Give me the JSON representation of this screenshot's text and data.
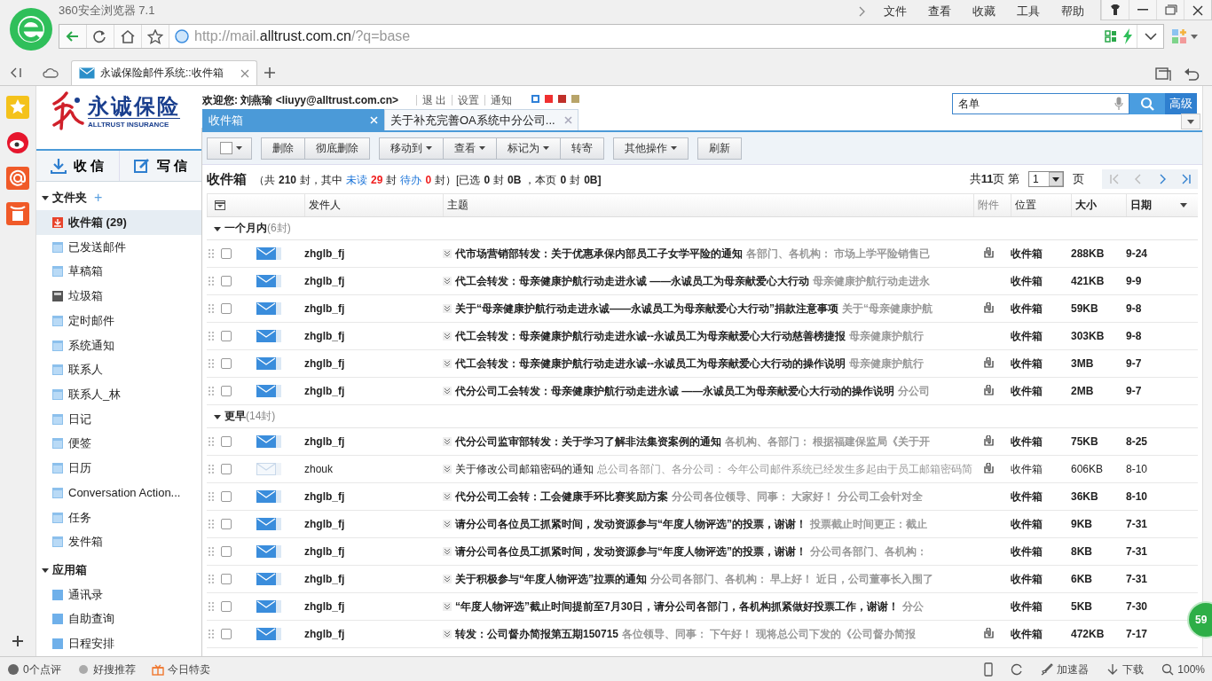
{
  "browser": {
    "title": "360安全浏览器 7.1",
    "menu": [
      "文件",
      "查看",
      "收藏",
      "工具",
      "帮助"
    ],
    "address": {
      "prefix": "http://mail.",
      "domain": "alltrust.com.cn",
      "suffix": "/?q=base"
    },
    "tabs": [
      {
        "label": "永诚保险邮件系统::收件箱",
        "selected": true
      }
    ]
  },
  "mail": {
    "logo": {
      "name": "永诚保险",
      "english": "ALLTRUST INSURANCE"
    },
    "welcome": "欢迎您: 刘燕瑜 <liuyy@alltrust.com.cn>",
    "header_links": [
      "退 出",
      "设置",
      "通知"
    ],
    "skins": [
      {
        "color": "#2f80d8",
        "selected": true
      },
      {
        "color": "#f03030",
        "selected": false
      },
      {
        "color": "#c0302a",
        "selected": false
      },
      {
        "color": "#b8a46a",
        "selected": false
      }
    ],
    "search": {
      "value": "名单",
      "advanced": "高级"
    },
    "actions": [
      "收 信",
      "写 信"
    ],
    "folder_sections": [
      {
        "title": "文件夹",
        "expanded": true,
        "add": "+",
        "items": [
          {
            "label": "收件箱 (29)",
            "kind": "inbox",
            "selected": true
          },
          {
            "label": "已发送邮件",
            "kind": "folder",
            "selected": false
          },
          {
            "label": "草稿箱",
            "kind": "folder",
            "selected": false
          },
          {
            "label": "垃圾箱",
            "kind": "trash",
            "selected": false
          },
          {
            "label": "定时邮件",
            "kind": "folder",
            "selected": false
          },
          {
            "label": "系统通知",
            "kind": "folder",
            "selected": false
          },
          {
            "label": "联系人",
            "kind": "folder",
            "selected": false
          },
          {
            "label": "联系人_林",
            "kind": "folder",
            "selected": false
          },
          {
            "label": "日记",
            "kind": "folder",
            "selected": false
          },
          {
            "label": "便签",
            "kind": "folder",
            "selected": false
          },
          {
            "label": "日历",
            "kind": "folder",
            "selected": false
          },
          {
            "label": "Conversation Action...",
            "kind": "folder",
            "selected": false
          },
          {
            "label": "任务",
            "kind": "folder",
            "selected": false
          },
          {
            "label": "发件箱",
            "kind": "folder",
            "selected": false
          }
        ]
      },
      {
        "title": "应用箱",
        "expanded": true,
        "items": [
          {
            "label": "通讯录",
            "kind": "app",
            "selected": false
          },
          {
            "label": "自助查询",
            "kind": "app",
            "selected": false
          },
          {
            "label": "日程安排",
            "kind": "app",
            "selected": false
          }
        ]
      }
    ],
    "tabs": [
      {
        "label": "收件箱",
        "selected": true
      },
      {
        "label": "关于补充完善OA系统中分公司...",
        "selected": false
      }
    ],
    "toolbar": [
      {
        "group": [
          {
            "kind": "select"
          }
        ]
      },
      {
        "group": [
          {
            "label": "删除"
          },
          {
            "label": "彻底删除"
          }
        ]
      },
      {
        "group": [
          {
            "label": "移动到",
            "menu": true
          },
          {
            "label": "查看",
            "menu": true
          },
          {
            "label": "标记为",
            "menu": true
          },
          {
            "label": "转寄"
          }
        ]
      },
      {
        "group": [
          {
            "label": "其他操作",
            "menu": true
          }
        ]
      },
      {
        "group": [
          {
            "label": "刷新"
          }
        ]
      }
    ],
    "summary": [
      {
        "text": "收件箱",
        "kind": "title"
      },
      {
        "text": "（共",
        "kind": "text"
      },
      {
        "text": "210",
        "kind": "num"
      },
      {
        "text": "封，其中",
        "kind": "text"
      },
      {
        "text": "未读",
        "kind": "link"
      },
      {
        "text": "29",
        "kind": "alert"
      },
      {
        "text": "封",
        "kind": "text"
      },
      {
        "text": "待办",
        "kind": "link"
      },
      {
        "text": "0",
        "kind": "alert"
      },
      {
        "text": "封）[已选",
        "kind": "text"
      },
      {
        "text": "0",
        "kind": "num"
      },
      {
        "text": "封",
        "kind": "text"
      },
      {
        "text": "0B",
        "kind": "num"
      },
      {
        "text": "，本页",
        "kind": "text"
      },
      {
        "text": "0",
        "kind": "num"
      },
      {
        "text": "封",
        "kind": "text"
      },
      {
        "text": "0B]",
        "kind": "num"
      }
    ],
    "pager": {
      "total_prefix": "共",
      "total": "11",
      "total_suffix": "页 第",
      "page": "1",
      "page_suffix": "页",
      "buttons": [
        {
          "kind": "first",
          "disabled": true
        },
        {
          "kind": "prev",
          "disabled": true
        },
        {
          "kind": "next",
          "disabled": false
        },
        {
          "kind": "last",
          "disabled": false
        }
      ]
    },
    "columns": [
      "发件人",
      "主题",
      "附件",
      "位置",
      "大小",
      "日期"
    ],
    "groups": [
      {
        "title": "一个月内",
        "count": "(6封)",
        "expanded": true,
        "rows": [
          {
            "sender": "zhglb_fj",
            "unread": true,
            "checked": false,
            "subject": "代市场营销部转发：关于优惠承保内部员工子女学平险的通知",
            "preview": "各部门、各机构：  市场上学平险销售已",
            "attachment": true,
            "folder": "收件箱",
            "size": "288KB",
            "date": "9-24"
          },
          {
            "sender": "zhglb_fj",
            "unread": true,
            "checked": false,
            "subject": "代工会转发：母亲健康护航行动走进永诚 ——永诚员工为母亲献爱心大行动",
            "preview": "母亲健康护航行动走进永",
            "attachment": false,
            "folder": "收件箱",
            "size": "421KB",
            "date": "9-9"
          },
          {
            "sender": "zhglb_fj",
            "unread": true,
            "checked": false,
            "subject": "关于“母亲健康护航行动走进永诚——永诚员工为母亲献爱心大行动”捐款注意事项",
            "preview": "关于“母亲健康护航",
            "attachment": true,
            "folder": "收件箱",
            "size": "59KB",
            "date": "9-8"
          },
          {
            "sender": "zhglb_fj",
            "unread": true,
            "checked": false,
            "subject": "代工会转发：母亲健康护航行动走进永诚--永诚员工为母亲献爱心大行动慈善榜捷报",
            "preview": "母亲健康护航行",
            "attachment": false,
            "folder": "收件箱",
            "size": "303KB",
            "date": "9-8"
          },
          {
            "sender": "zhglb_fj",
            "unread": true,
            "checked": false,
            "subject": "代工会转发：母亲健康护航行动走进永诚--永诚员工为母亲献爱心大行动的操作说明",
            "preview": "母亲健康护航行",
            "attachment": true,
            "folder": "收件箱",
            "size": "3MB",
            "date": "9-7"
          },
          {
            "sender": "zhglb_fj",
            "unread": true,
            "checked": false,
            "subject": "代分公司工会转发：母亲健康护航行动走进永诚 ——永诚员工为母亲献爱心大行动的操作说明",
            "preview": "分公司",
            "attachment": true,
            "folder": "收件箱",
            "size": "2MB",
            "date": "9-7"
          }
        ]
      },
      {
        "title": "更早",
        "count": "(14封)",
        "expanded": true,
        "rows": [
          {
            "sender": "zhglb_fj",
            "unread": true,
            "checked": false,
            "subject": "代分公司监审部转发：关于学习了解非法集资案例的通知",
            "preview": "各机构、各部门：  根据福建保监局《关于开",
            "attachment": true,
            "folder": "收件箱",
            "size": "75KB",
            "date": "8-25"
          },
          {
            "sender": "zhouk",
            "unread": false,
            "checked": false,
            "subject": "关于修改公司邮箱密码的通知",
            "preview": "总公司各部门、各分公司：  今年公司邮件系统已经发生多起由于员工邮箱密码简",
            "attachment": true,
            "folder": "收件箱",
            "size": "606KB",
            "date": "8-10"
          },
          {
            "sender": "zhglb_fj",
            "unread": true,
            "checked": false,
            "subject": "代分公司工会转：工会健康手环比赛奖励方案",
            "preview": "分公司各位领导、同事：  大家好！  分公司工会针对全",
            "attachment": false,
            "folder": "收件箱",
            "size": "36KB",
            "date": "8-10"
          },
          {
            "sender": "zhglb_fj",
            "unread": true,
            "checked": false,
            "subject": "请分公司各位员工抓紧时间，发动资源参与“年度人物评选”的投票，谢谢！",
            "preview": "投票截止时间更正：截止",
            "attachment": false,
            "folder": "收件箱",
            "size": "9KB",
            "date": "7-31"
          },
          {
            "sender": "zhglb_fj",
            "unread": true,
            "checked": false,
            "subject": "请分公司各位员工抓紧时间，发动资源参与“年度人物评选”的投票，谢谢！",
            "preview": "分公司各部门、各机构：",
            "attachment": false,
            "folder": "收件箱",
            "size": "8KB",
            "date": "7-31"
          },
          {
            "sender": "zhglb_fj",
            "unread": true,
            "checked": false,
            "subject": "关于积极参与“年度人物评选”拉票的通知",
            "preview": "分公司各部门、各机构：  早上好！  近日，公司董事长入围了",
            "attachment": false,
            "folder": "收件箱",
            "size": "6KB",
            "date": "7-31"
          },
          {
            "sender": "zhglb_fj",
            "unread": true,
            "checked": false,
            "subject": "“年度人物评选”截止时间提前至7月30日，请分公司各部门，各机构抓紧做好投票工作，谢谢！",
            "preview": "分公",
            "attachment": false,
            "folder": "收件箱",
            "size": "5KB",
            "date": "7-30"
          },
          {
            "sender": "zhglb_fj",
            "unread": true,
            "checked": false,
            "subject": "转发：公司督办简报第五期150715",
            "preview": "各位领导、同事：  下午好！  现将总公司下发的《公司督办简报",
            "attachment": true,
            "folder": "收件箱",
            "size": "472KB",
            "date": "7-17"
          }
        ]
      }
    ]
  },
  "float_badge": "59",
  "status_bar": {
    "left": [
      "0个点评",
      "好搜推荐",
      "今日特卖"
    ],
    "right": [
      "加速器",
      "下载"
    ],
    "zoom": "100%"
  }
}
